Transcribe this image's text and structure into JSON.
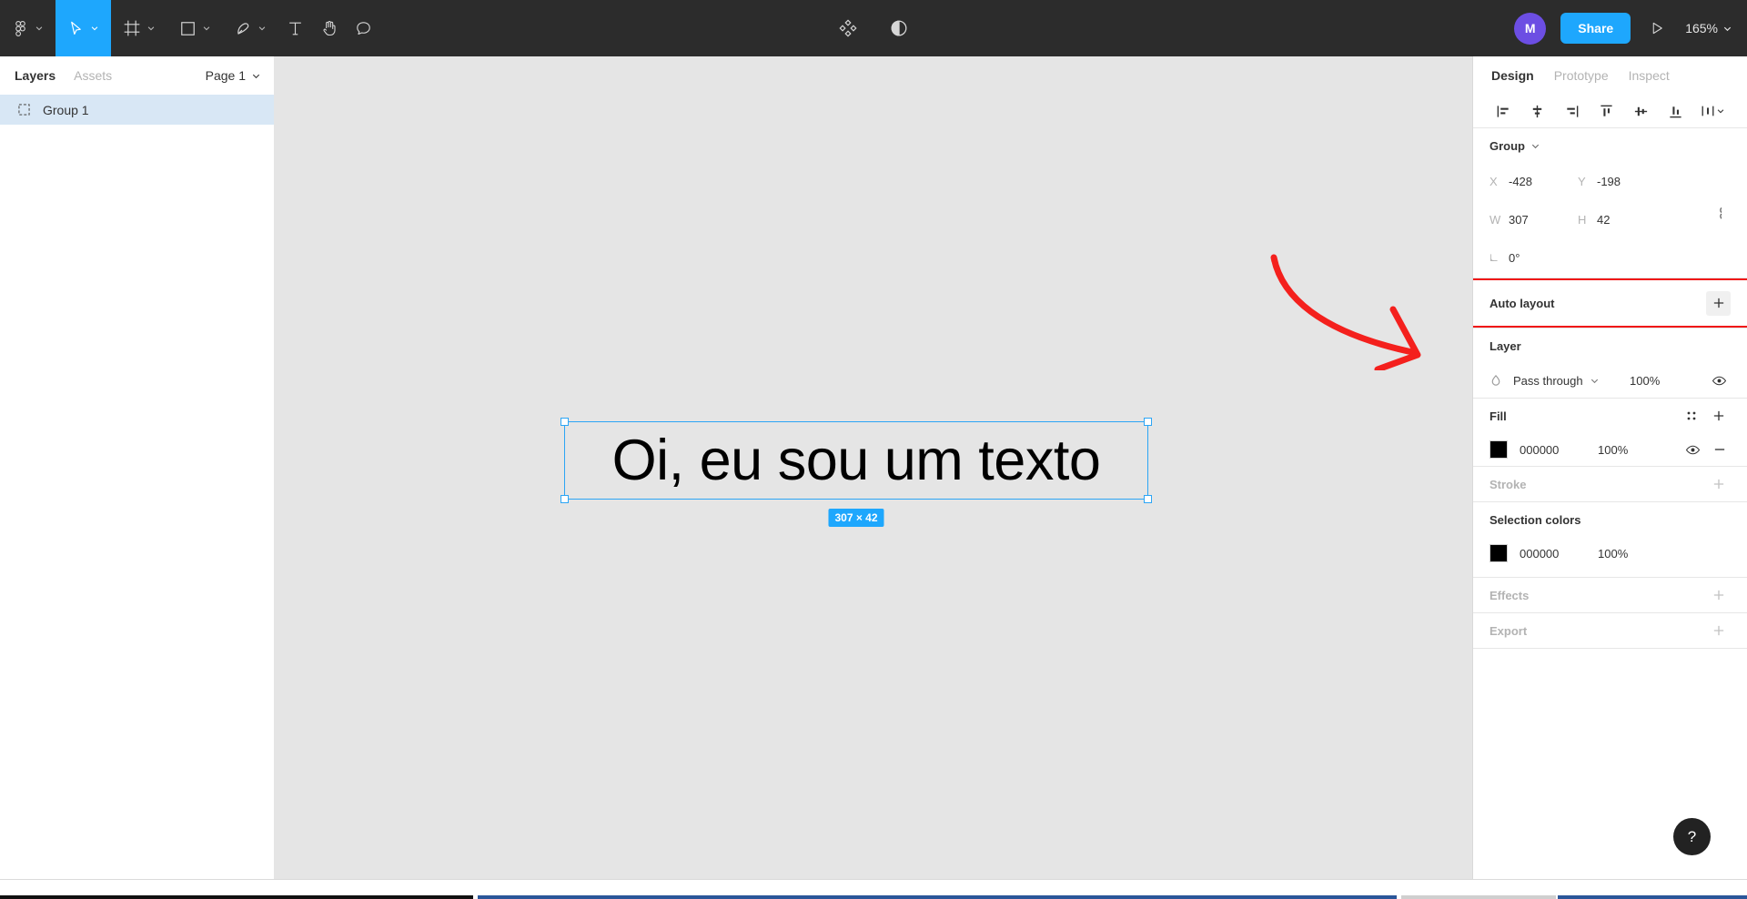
{
  "app": {
    "name": "Figma",
    "zoom_level": "165%",
    "share_label": "Share",
    "avatar_initial": "M",
    "accent_blue": "#1ea7fd",
    "avatar_color": "#6c4ee3",
    "highlight_red": "#f01414",
    "canvas_bg": "#e5e5e5",
    "toolbar_bg": "#2c2c2c"
  },
  "toolbar": {
    "tools": [
      {
        "name": "figma-menu-icon",
        "has_chevron": true,
        "active": false
      },
      {
        "name": "move-tool-icon",
        "has_chevron": true,
        "active": true
      },
      {
        "name": "frame-tool-icon",
        "has_chevron": true,
        "active": false
      },
      {
        "name": "shape-tool-icon",
        "has_chevron": true,
        "active": false
      },
      {
        "name": "pen-tool-icon",
        "has_chevron": true,
        "active": false
      },
      {
        "name": "text-tool-icon",
        "has_chevron": false,
        "active": false
      },
      {
        "name": "hand-tool-icon",
        "has_chevron": false,
        "active": false
      },
      {
        "name": "comment-tool-icon",
        "has_chevron": false,
        "active": false
      }
    ],
    "center_icons": [
      {
        "name": "components-icon"
      },
      {
        "name": "contrast-icon"
      }
    ]
  },
  "left_panel": {
    "tabs": [
      {
        "label": "Layers",
        "active": true
      },
      {
        "label": "Assets",
        "active": false
      }
    ],
    "page_selector": "Page 1",
    "layers": [
      {
        "name": "Group 1",
        "icon": "group-icon",
        "selected": true
      }
    ]
  },
  "canvas": {
    "text_element": "Oi, eu sou um texto",
    "dimension_badge": "307 × 42",
    "annotation": "red-curved-arrow-pointing-to-auto-layout"
  },
  "right_panel": {
    "tabs": [
      {
        "label": "Design",
        "active": true
      },
      {
        "label": "Prototype",
        "active": false
      },
      {
        "label": "Inspect",
        "active": false
      }
    ],
    "align_buttons": [
      "align-left-icon",
      "align-horizontal-center-icon",
      "align-right-icon",
      "align-top-icon",
      "align-vertical-center-icon",
      "align-bottom-icon",
      "distribute-icon"
    ],
    "selection": {
      "type_label": "Group",
      "x_label": "X",
      "x_value": "-428",
      "y_label": "Y",
      "y_value": "-198",
      "w_label": "W",
      "w_value": "307",
      "h_label": "H",
      "h_value": "42",
      "rotation_value": "0°"
    },
    "auto_layout": {
      "label": "Auto layout",
      "add_label": "+",
      "highlighted": true
    },
    "layer": {
      "title": "Layer",
      "blend_mode": "Pass through",
      "opacity": "100%"
    },
    "fill": {
      "title": "Fill",
      "hex": "000000",
      "opacity": "100%",
      "swatch_color": "#000000"
    },
    "stroke": {
      "title": "Stroke"
    },
    "selection_colors": {
      "title": "Selection colors",
      "hex": "000000",
      "opacity": "100%",
      "swatch_color": "#000000"
    },
    "effects": {
      "title": "Effects"
    },
    "export": {
      "title": "Export"
    }
  },
  "help": {
    "label": "?"
  }
}
